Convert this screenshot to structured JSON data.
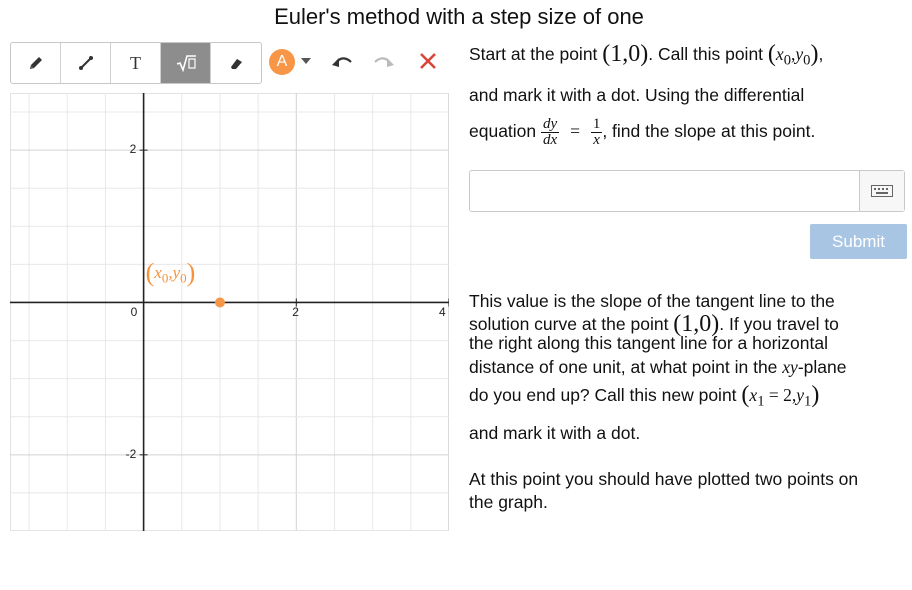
{
  "title": "Euler's method with a step size of one",
  "toolbar": {
    "tools": [
      "pencil-icon",
      "line-icon",
      "text-icon",
      "math-icon",
      "eraser-icon"
    ],
    "text_tool_glyph": "T",
    "active_tool": "math-icon",
    "color_letter": "A",
    "accent_color": "#f79646"
  },
  "graph": {
    "x_ticks": [
      "0",
      "2",
      "4"
    ],
    "y_ticks": [
      "2",
      "-2"
    ],
    "x_range": [
      -1.75,
      4.0
    ],
    "y_range": [
      -3.0,
      2.75
    ],
    "point": {
      "x": 1,
      "y": 0,
      "color": "#f79646"
    },
    "point_label": {
      "var_x": "x",
      "sub_x": "0",
      "var_y": "y",
      "sub_y": "0"
    }
  },
  "panel": {
    "p1": {
      "a": "Start at the point ",
      "point": "(1,0)",
      "b": ". Call this point ",
      "label_x": "x",
      "label_x_sub": "0",
      "label_y": "y",
      "label_y_sub": "0",
      "c": ","
    },
    "p2": "and mark it with a dot. Using the differential",
    "p3": {
      "a": "equation ",
      "dy": "dy",
      "dx": "dx",
      "eq": "=",
      "one": "1",
      "x": "x",
      "b": ", find the slope at this point."
    },
    "submit_label": "Submit",
    "p4": "This value is the slope of the tangent line to the",
    "p5": {
      "a": "solution curve at the point ",
      "point": "(1,0)",
      "b": ". If you travel to"
    },
    "p6": "the right along this tangent line for a horizontal",
    "p7": {
      "a": "distance of one unit, at what point in the ",
      "xy": "xy",
      "b": "-plane"
    },
    "p8": {
      "a": "do you end up? Call this new point ",
      "x": "x",
      "x_sub": "1",
      "eq": " = 2,",
      "y": "y",
      "y_sub": "1"
    },
    "p9": "and mark it with a dot.",
    "p10": "At this point you should have plotted two points on",
    "p11": "the graph."
  }
}
